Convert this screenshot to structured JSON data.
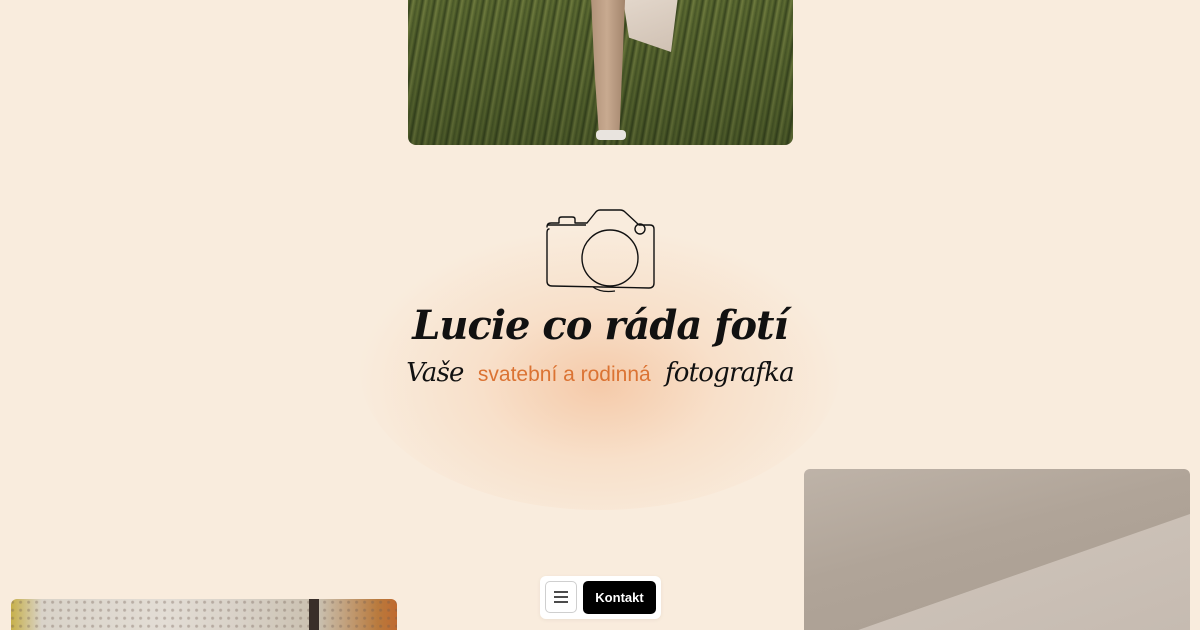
{
  "hero": {
    "title": "Lucie co ráda fotí",
    "subtitle_prefix": "Vaše",
    "subtitle_accent": "svatební a rodinná",
    "subtitle_suffix": "fotografka",
    "accent_color": "#db7333",
    "icon": "camera-icon"
  },
  "bottom_nav": {
    "menu_icon": "hamburger-menu-icon",
    "contact_label": "Kontakt"
  },
  "colors": {
    "background": "#f9ecdd",
    "text": "#111111",
    "button": "#000000"
  }
}
